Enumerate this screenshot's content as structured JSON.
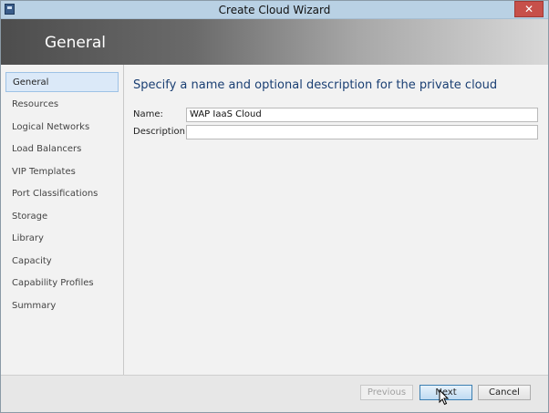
{
  "window": {
    "title": "Create Cloud Wizard",
    "close_glyph": "✕"
  },
  "header": {
    "title": "General"
  },
  "nav": {
    "items": [
      {
        "label": "General",
        "active": true
      },
      {
        "label": "Resources"
      },
      {
        "label": "Logical Networks"
      },
      {
        "label": "Load Balancers"
      },
      {
        "label": "VIP Templates"
      },
      {
        "label": "Port Classifications"
      },
      {
        "label": "Storage"
      },
      {
        "label": "Library"
      },
      {
        "label": "Capacity"
      },
      {
        "label": "Capability Profiles"
      },
      {
        "label": "Summary"
      }
    ]
  },
  "main": {
    "heading": "Specify a name and optional description for the private cloud",
    "name_label": "Name:",
    "name_value": "WAP IaaS Cloud",
    "description_label": "Description:",
    "description_value": ""
  },
  "footer": {
    "previous_label": "Previous",
    "next_label": "Next",
    "cancel_label": "Cancel"
  },
  "colors": {
    "titlebar": "#b9d1e4",
    "heading": "#1a3f73",
    "active_nav": "#dbe9f8",
    "close_button": "#c7504a"
  }
}
